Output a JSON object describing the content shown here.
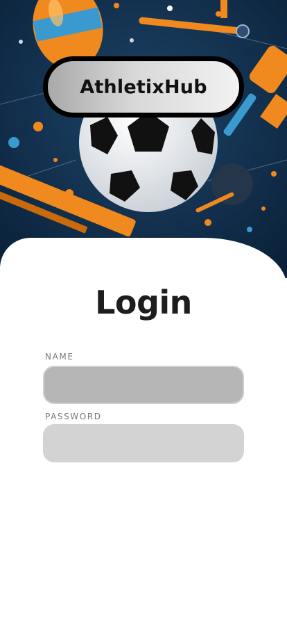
{
  "brand": {
    "name": "AthletixHub"
  },
  "login": {
    "title": "Login",
    "name_label": "NAME",
    "name_value": "",
    "password_label": "PASSWORD",
    "password_value": ""
  },
  "colors": {
    "hero_bg": "#0f2a45",
    "accent_orange": "#f0891e",
    "text_dark": "#1d1d1d",
    "field_name_bg": "#b6b6b6",
    "field_password_bg": "#d3d3d3"
  }
}
